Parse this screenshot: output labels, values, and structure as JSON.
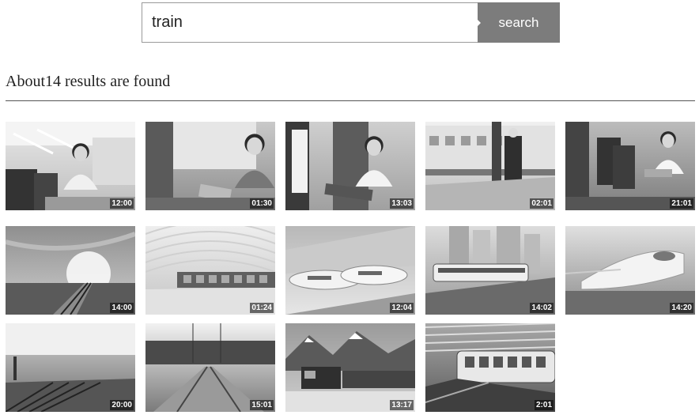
{
  "search": {
    "query": "train",
    "button_label": "search"
  },
  "results": {
    "summary": "About14 results are found",
    "videos": [
      {
        "duration": "12:00",
        "scene": "woman-window-seat"
      },
      {
        "duration": "01:30",
        "scene": "man-tablet-window"
      },
      {
        "duration": "13:03",
        "scene": "woman-smiling-tablet"
      },
      {
        "duration": "02:01",
        "scene": "conductor-platform"
      },
      {
        "duration": "21:01",
        "scene": "woman-laptop-aisle"
      },
      {
        "duration": "14:00",
        "scene": "rails-sunset"
      },
      {
        "duration": "01:24",
        "scene": "station-canopy"
      },
      {
        "duration": "12:04",
        "scene": "bullet-trains-motion"
      },
      {
        "duration": "14:02",
        "scene": "city-metro"
      },
      {
        "duration": "14:20",
        "scene": "bullet-train-blur"
      },
      {
        "duration": "20:00",
        "scene": "rail-yard"
      },
      {
        "duration": "15:01",
        "scene": "tracks-motion"
      },
      {
        "duration": "13:17",
        "scene": "freight-mountains"
      },
      {
        "duration": "2:01",
        "scene": "metro-station"
      }
    ]
  }
}
